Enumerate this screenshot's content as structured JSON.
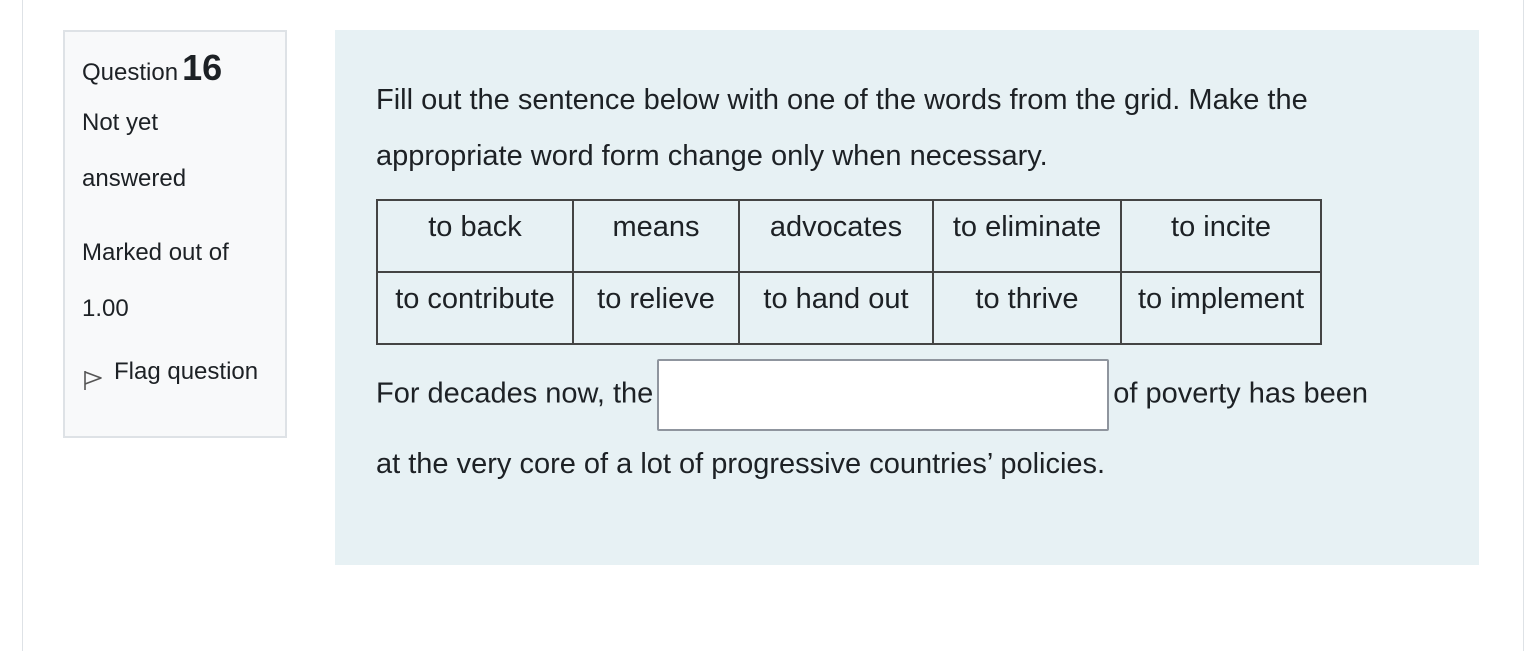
{
  "info": {
    "question_label": "Question",
    "question_number": "16",
    "state_line1": "Not yet",
    "state_line2": "answered",
    "grade_line1": "Marked out of",
    "grade_line2": "1.00",
    "flag_label": "Flag question",
    "flag_icon": "flag-outline-icon"
  },
  "question": {
    "prompt_line1": "Fill out the sentence below with one of the words from the grid. Make the",
    "prompt_line2": "appropriate word form change only when necessary.",
    "grid": [
      [
        "to back",
        "means",
        "advocates",
        "to eliminate",
        "to incite"
      ],
      [
        "to contribute",
        "to relieve",
        "to hand out",
        "to thrive",
        "to implement"
      ]
    ],
    "sentence_before": "For decades now, the",
    "sentence_after_line1": "of poverty has been",
    "sentence_after_line2": "at the very core of a lot of progressive countries’ policies.",
    "answer_value": ""
  }
}
